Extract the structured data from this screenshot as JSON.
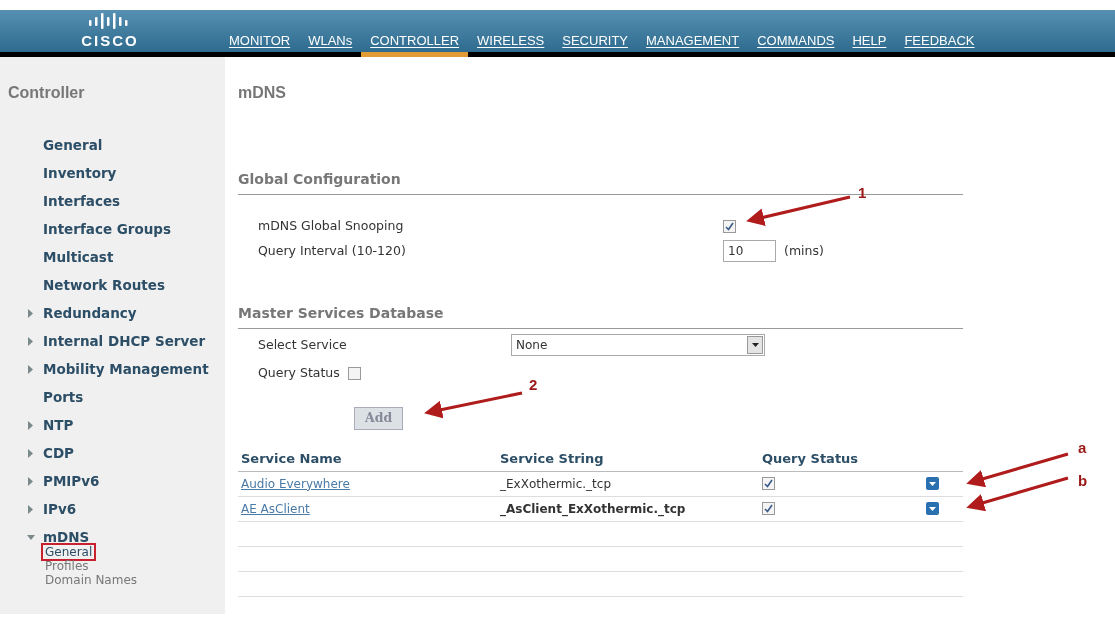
{
  "header": {
    "logo": "CISCO",
    "menu": [
      {
        "label": "MONITOR",
        "selected": false
      },
      {
        "label": "WLANs",
        "selected": false
      },
      {
        "label": "CONTROLLER",
        "selected": true
      },
      {
        "label": "WIRELESS",
        "selected": false
      },
      {
        "label": "SECURITY",
        "selected": false
      },
      {
        "label": "MANAGEMENT",
        "selected": false
      },
      {
        "label": "COMMANDS",
        "selected": false
      },
      {
        "label": "HELP",
        "selected": false
      },
      {
        "label": "FEEDBACK",
        "selected": false
      }
    ]
  },
  "sidebar": {
    "title": "Controller",
    "items": [
      {
        "label": "General",
        "kind": "link"
      },
      {
        "label": "Inventory",
        "kind": "link"
      },
      {
        "label": "Interfaces",
        "kind": "link"
      },
      {
        "label": "Interface Groups",
        "kind": "link"
      },
      {
        "label": "Multicast",
        "kind": "link"
      },
      {
        "label": "Network Routes",
        "kind": "link"
      },
      {
        "label": "Redundancy",
        "kind": "group",
        "expanded": false
      },
      {
        "label": "Internal DHCP Server",
        "kind": "group",
        "expanded": false
      },
      {
        "label": "Mobility Management",
        "kind": "group",
        "expanded": false
      },
      {
        "label": "Ports",
        "kind": "link"
      },
      {
        "label": "NTP",
        "kind": "group",
        "expanded": false
      },
      {
        "label": "CDP",
        "kind": "group",
        "expanded": false
      },
      {
        "label": "PMIPv6",
        "kind": "group",
        "expanded": false
      },
      {
        "label": "IPv6",
        "kind": "group",
        "expanded": false
      },
      {
        "label": "mDNS",
        "kind": "group",
        "expanded": true,
        "children": [
          {
            "label": "General",
            "selected": true
          },
          {
            "label": "Profiles",
            "selected": false
          },
          {
            "label": "Domain Names",
            "selected": false
          }
        ]
      }
    ]
  },
  "page_title": "mDNS",
  "global_configuration": {
    "heading": "Global Configuration",
    "snooping_label": "mDNS Global Snooping",
    "snooping_checked": true,
    "interval_label": "Query Interval (10-120)",
    "interval_value": "10",
    "interval_unit": "(mins)"
  },
  "master_services": {
    "heading": "Master Services Database",
    "select_label": "Select Service",
    "select_value": "None",
    "query_status_label": "Query Status",
    "query_status_checked": false,
    "add_button": "Add"
  },
  "table": {
    "columns": [
      "Service Name",
      "Service String",
      "Query Status"
    ],
    "rows": [
      {
        "name": "Audio Everywhere",
        "string": "_ExXothermic._tcp",
        "emphasized": false,
        "query_status": true
      },
      {
        "name": "AE AsClient",
        "string": "_AsClient_ExXothermic._tcp",
        "emphasized": true,
        "query_status": true
      }
    ]
  },
  "annotations": [
    "1",
    "2",
    "a",
    "b"
  ]
}
